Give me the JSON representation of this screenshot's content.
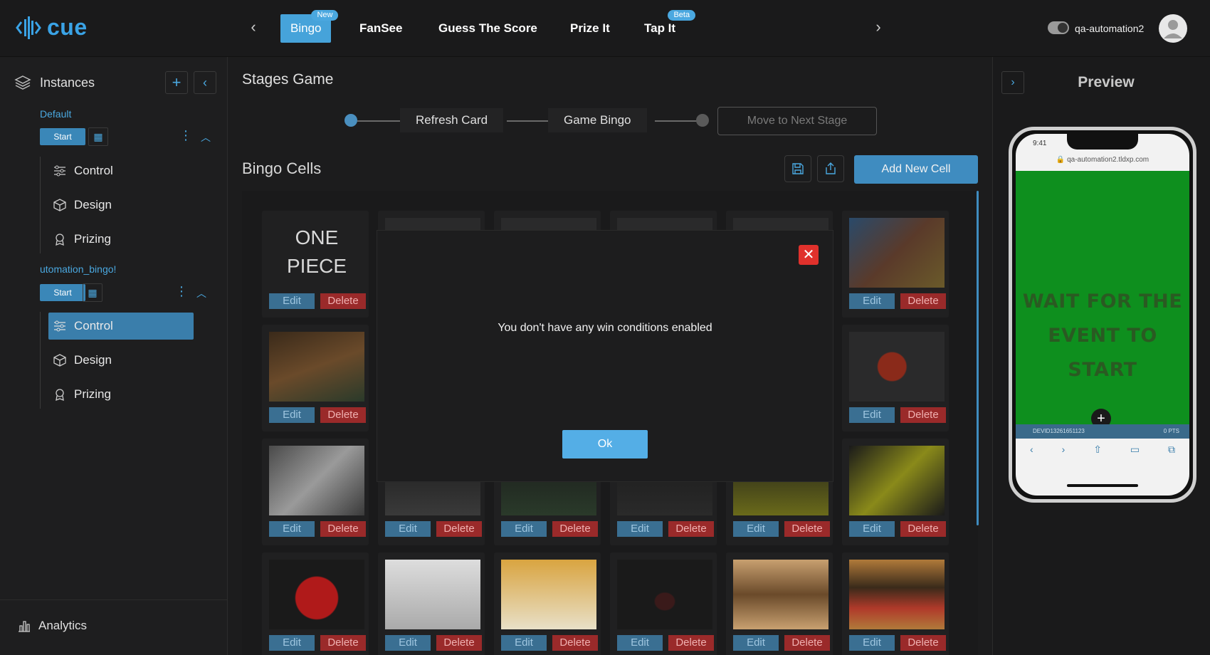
{
  "app": {
    "logo_text": "cue"
  },
  "topnav": {
    "tabs": [
      {
        "label": "Bingo",
        "badge": "New",
        "active": true
      },
      {
        "label": "FanSee"
      },
      {
        "label": "Guess The Score"
      },
      {
        "label": "Prize It"
      },
      {
        "label": "Tap It",
        "badge": "Beta"
      }
    ],
    "username": "qa-automation2"
  },
  "sidebar": {
    "title": "Instances",
    "instances": [
      {
        "name": "Default",
        "start_label": "Start",
        "items": [
          {
            "label": "Control",
            "icon": "sliders-icon"
          },
          {
            "label": "Design",
            "icon": "cube-icon"
          },
          {
            "label": "Prizing",
            "icon": "award-icon"
          }
        ]
      },
      {
        "name": "utomation_bingo!",
        "start_label": "Start",
        "items": [
          {
            "label": "Control",
            "icon": "sliders-icon",
            "active": true
          },
          {
            "label": "Design",
            "icon": "cube-icon"
          },
          {
            "label": "Prizing",
            "icon": "award-icon"
          }
        ]
      }
    ],
    "footer": {
      "label": "Analytics"
    }
  },
  "main": {
    "title": "Stages Game",
    "stages": [
      "Refresh Card",
      "Game Bingo"
    ],
    "next_stage_label": "Move to Next Stage",
    "cells_title": "Bingo Cells",
    "add_cell_label": "Add New Cell",
    "edit_label": "Edit",
    "delete_label": "Delete",
    "text_cell": "ONE PIECE"
  },
  "modal": {
    "message": "You don't have any win conditions enabled",
    "ok_label": "Ok"
  },
  "preview": {
    "title": "Preview",
    "phone_time": "9:41",
    "url": "qa-automation2.tldxp.com",
    "wait_line1": "WAIT FOR THE",
    "wait_line2": "EVENT TO START",
    "status_left": "DEVID13261651123",
    "status_right": "0 PTS"
  },
  "colors": {
    "accent": "#46a3da",
    "danger": "#e0312c",
    "preview_green": "#0e8f1e"
  }
}
